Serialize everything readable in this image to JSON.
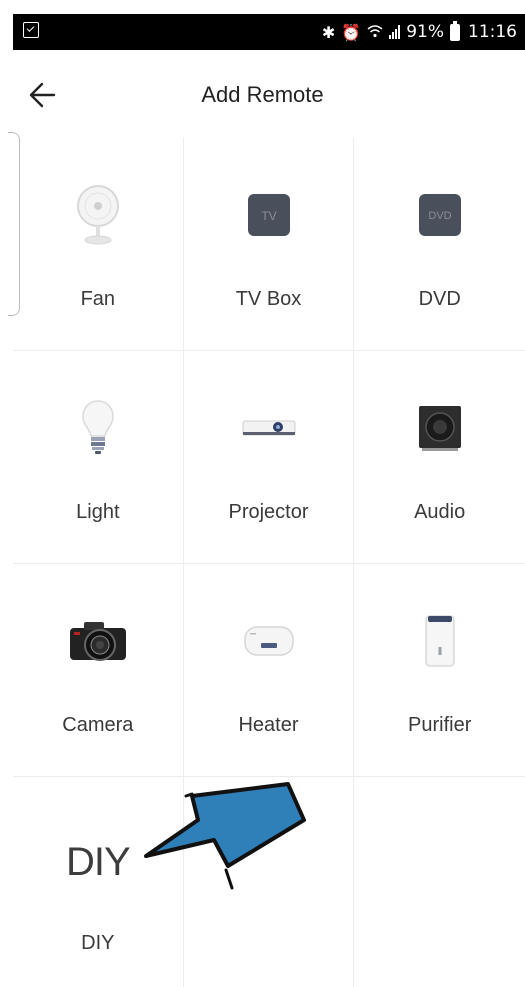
{
  "status_bar": {
    "battery": "91%",
    "time": "11:16",
    "icons": [
      "screenshot-icon",
      "bluetooth-icon",
      "alarm-icon",
      "wifi-icon",
      "signal-icon",
      "battery-icon"
    ]
  },
  "header": {
    "title": "Add Remote",
    "back_icon": "arrow-left-icon"
  },
  "grid": {
    "items": [
      {
        "label": "Fan",
        "icon": "fan-icon"
      },
      {
        "label": "TV Box",
        "icon": "tv-box-icon",
        "icon_text": "TV"
      },
      {
        "label": "DVD",
        "icon": "dvd-icon",
        "icon_text": "DVD"
      },
      {
        "label": "Light",
        "icon": "light-bulb-icon"
      },
      {
        "label": "Projector",
        "icon": "projector-icon"
      },
      {
        "label": "Audio",
        "icon": "speaker-icon"
      },
      {
        "label": "Camera",
        "icon": "camera-icon"
      },
      {
        "label": "Heater",
        "icon": "water-heater-icon"
      },
      {
        "label": "Purifier",
        "icon": "air-purifier-icon"
      },
      {
        "label": "DIY",
        "icon": "diy-text-icon",
        "icon_text": "DIY"
      }
    ]
  },
  "annotation": {
    "arrow_color": "#2f7fb8",
    "icon": "blue-arrow-annotation"
  }
}
